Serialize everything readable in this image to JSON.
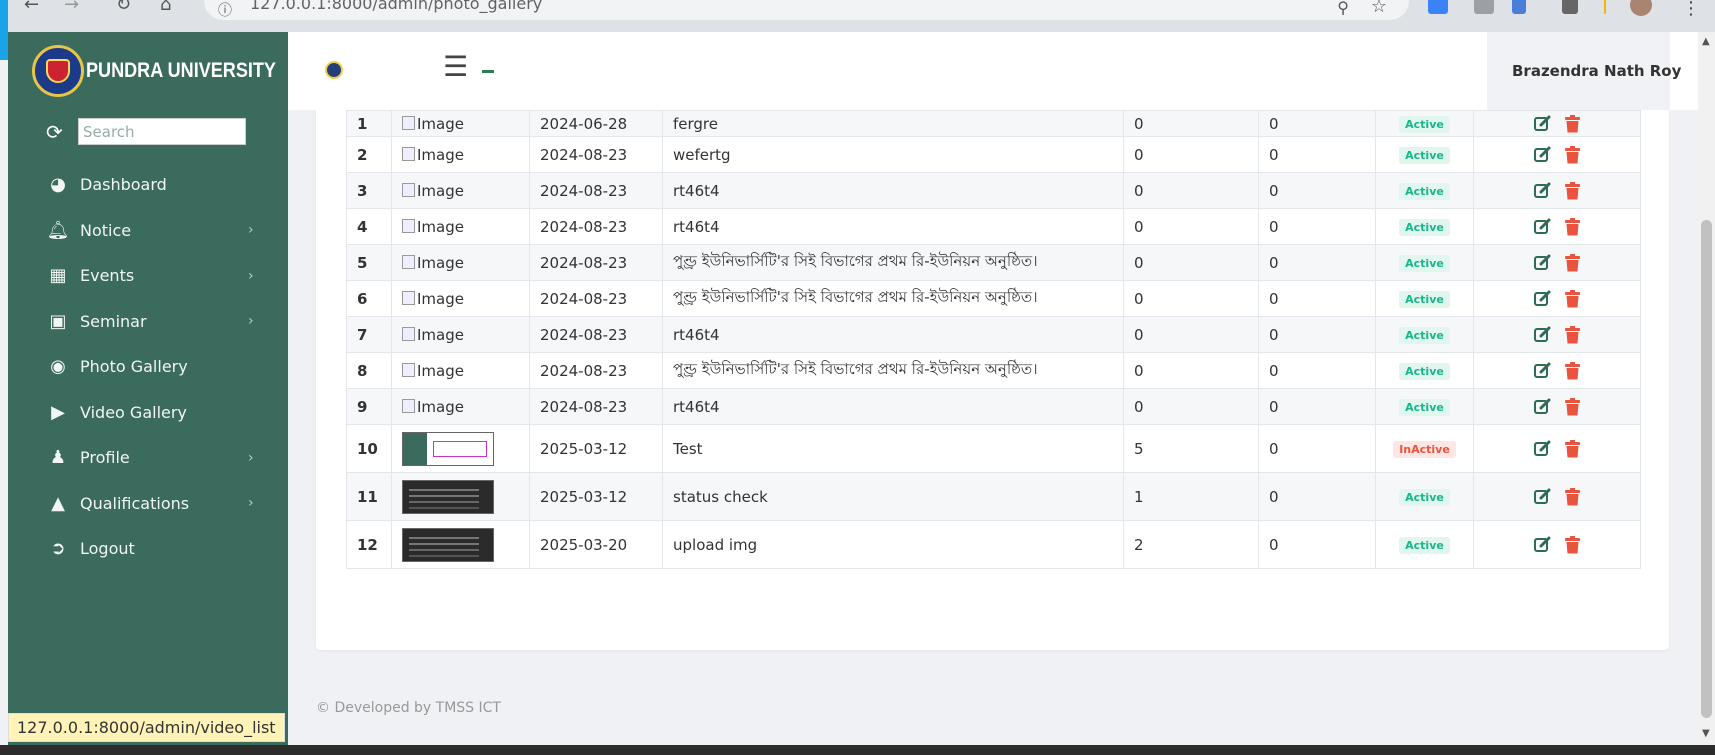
{
  "browser": {
    "url": "127.0.0.1:8000/admin/photo_gallery",
    "status_url": "127.0.0.1:8000/admin/video_list"
  },
  "sidebar": {
    "brand": "PUNDRA UNIVERSITY",
    "search_placeholder": "Search",
    "items": [
      {
        "label": "Dashboard",
        "icon": "dashboard-icon",
        "has_submenu": false
      },
      {
        "label": "Notice",
        "icon": "bell-icon",
        "has_submenu": true
      },
      {
        "label": "Events",
        "icon": "calendar-icon",
        "has_submenu": true
      },
      {
        "label": "Seminar",
        "icon": "presentation-icon",
        "has_submenu": true
      },
      {
        "label": "Photo Gallery",
        "icon": "camera-icon",
        "has_submenu": false
      },
      {
        "label": "Video Gallery",
        "icon": "video-icon",
        "has_submenu": false
      },
      {
        "label": "Profile",
        "icon": "user-icon",
        "has_submenu": true
      },
      {
        "label": "Qualifications",
        "icon": "graduation-cap-icon",
        "has_submenu": true
      },
      {
        "label": "Logout",
        "icon": "logout-icon",
        "has_submenu": false
      }
    ]
  },
  "header": {
    "user_name": "Brazendra Nath Roy"
  },
  "table": {
    "image_alt": "Image",
    "rows": [
      {
        "sn": "1",
        "date": "2024-06-28",
        "title": "fergre",
        "c1": "0",
        "c2": "0",
        "status": "Active",
        "thumb": "none"
      },
      {
        "sn": "2",
        "date": "2024-08-23",
        "title": "wefertg",
        "c1": "0",
        "c2": "0",
        "status": "Active",
        "thumb": "none"
      },
      {
        "sn": "3",
        "date": "2024-08-23",
        "title": "rt46t4",
        "c1": "0",
        "c2": "0",
        "status": "Active",
        "thumb": "none"
      },
      {
        "sn": "4",
        "date": "2024-08-23",
        "title": "rt46t4",
        "c1": "0",
        "c2": "0",
        "status": "Active",
        "thumb": "none"
      },
      {
        "sn": "5",
        "date": "2024-08-23",
        "title": "পুণ্ড্র ইউনিভার্সিটি'র সিই বিভাগের প্রথম রি-ইউনিয়ন অনুষ্ঠিত।",
        "c1": "0",
        "c2": "0",
        "status": "Active",
        "thumb": "none"
      },
      {
        "sn": "6",
        "date": "2024-08-23",
        "title": "পুণ্ড্র ইউনিভার্সিটি'র সিই বিভাগের প্রথম রি-ইউনিয়ন অনুষ্ঠিত।",
        "c1": "0",
        "c2": "0",
        "status": "Active",
        "thumb": "none"
      },
      {
        "sn": "7",
        "date": "2024-08-23",
        "title": "rt46t4",
        "c1": "0",
        "c2": "0",
        "status": "Active",
        "thumb": "none"
      },
      {
        "sn": "8",
        "date": "2024-08-23",
        "title": "পুণ্ড্র ইউনিভার্সিটি'র সিই বিভাগের প্রথম রি-ইউনিয়ন অনুষ্ঠিত।",
        "c1": "0",
        "c2": "0",
        "status": "Active",
        "thumb": "none"
      },
      {
        "sn": "9",
        "date": "2024-08-23",
        "title": "rt46t4",
        "c1": "0",
        "c2": "0",
        "status": "Active",
        "thumb": "none"
      },
      {
        "sn": "10",
        "date": "2025-03-12",
        "title": "Test",
        "c1": "5",
        "c2": "0",
        "status": "InActive",
        "thumb": "light"
      },
      {
        "sn": "11",
        "date": "2025-03-12",
        "title": "status check",
        "c1": "1",
        "c2": "0",
        "status": "Active",
        "thumb": "dark"
      },
      {
        "sn": "12",
        "date": "2025-03-20",
        "title": "upload img",
        "c1": "2",
        "c2": "0",
        "status": "Active",
        "thumb": "dark"
      }
    ]
  },
  "footer": {
    "text": "© Developed by TMSS ICT"
  },
  "colors": {
    "sidebar_bg": "#3a6b5c",
    "active_badge": "#1ab58a",
    "inactive_badge": "#e8543d",
    "edit_icon": "#2e6b55",
    "delete_icon": "#e8543d"
  }
}
